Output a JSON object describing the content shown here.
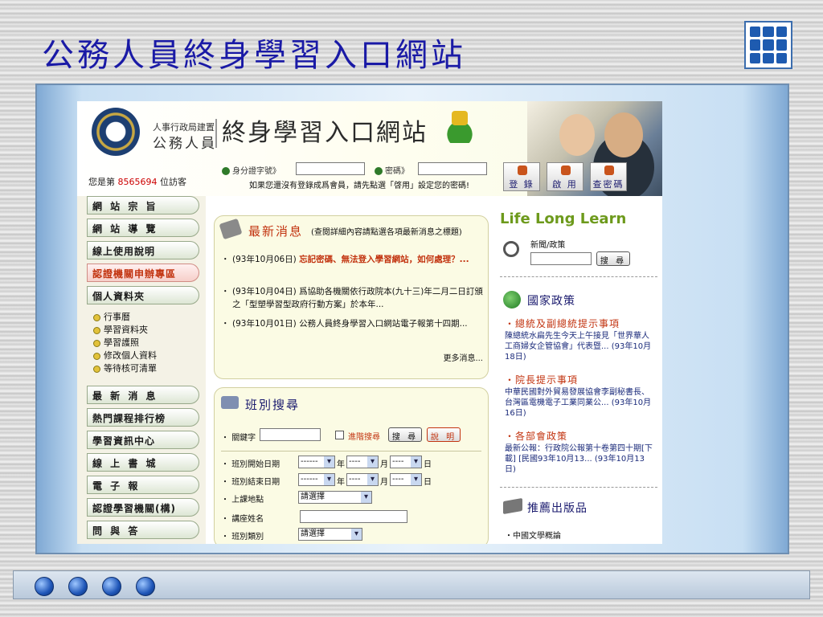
{
  "slide": {
    "title": "公務人員終身學習入口網站"
  },
  "header": {
    "org_line1": "人事行政局建置",
    "org_line2": "公務人員",
    "site_name": "終身學習入口網站",
    "visitor_prefix": "您是第",
    "visitor_count": "8565694",
    "visitor_suffix": "位訪客",
    "id_label": "身分證字號》",
    "pwd_label": "密碼》",
    "register_note": "如果您還沒有登錄成爲會員，請先點選「啓用」設定您的密碼!",
    "buttons": [
      "登 錄",
      "啟 用",
      "查密碼"
    ]
  },
  "leftnav": {
    "items": [
      "網 站 宗 旨",
      "網 站 導 覽",
      "線上使用說明",
      "認證機關申辦專區",
      "個人資料夾"
    ],
    "subitems": [
      "行事曆",
      "學習資料夾",
      "學習護照",
      "修改個人資料",
      "等待核可清單"
    ],
    "items2": [
      "最 新 消 息",
      "熱門課程排行榜",
      "學習資訊中心",
      "線 上 書 城",
      "電 子 報",
      "認證學習機關(構)",
      "問 與 答"
    ]
  },
  "news": {
    "title": "最新消息",
    "subtitle": "(查閱詳細內容請點選各項最新消息之標題)",
    "items": [
      {
        "date": "(93年10月06日)",
        "text": "忘記密碼、無法登入學習網站，如何處理？..."
      },
      {
        "date": "(93年10月04日)",
        "text": "爲協助各機關依行政院本(九十三)年二月二日訂頒之「型塑學習型政府行動方案」於本年..."
      },
      {
        "date": "(93年10月01日)",
        "text": "公務人員終身學習入口網站電子報第十四期..."
      }
    ],
    "more": "更多消息..."
  },
  "search": {
    "title": "班別搜尋",
    "keyword_label": "關鍵字",
    "advanced_label": "進階搜尋",
    "search_btn": "搜 尋",
    "help_btn": "說 明",
    "start_label": "班別開始日期",
    "end_label": "班別結束日期",
    "location_label": "上課地點",
    "teacher_label": "講座姓名",
    "class_type_label": "班別類別",
    "year_unit": "年",
    "month_unit": "月",
    "day_unit": "日",
    "year_value": "------",
    "md_value": "----",
    "select_placeholder": "請選擇"
  },
  "right": {
    "slogan": "Life Long Learn",
    "policy_search_label": "新聞/政策",
    "policy_search_btn": "搜 尋",
    "gov_title": "國家政策",
    "sections": [
      {
        "heading": "總統及副總統提示事項",
        "body": "陳總統水扁先生今天上午接見「世界華人工商婦女企管協會」代表暨... (93年10月18日)"
      },
      {
        "heading": "院長提示事項",
        "body": "中華民國對外貿易發展協會李副秘書長、台灣區電機電子工業同業公... (93年10月16日)"
      },
      {
        "heading": "各部會政策",
        "body": "最新公報：行政院公報第十卷第四十期[下載] [民國93年10月13... (93年10月13日)"
      }
    ],
    "pub_title": "推薦出版品",
    "pub_item": "中國文學概論"
  }
}
